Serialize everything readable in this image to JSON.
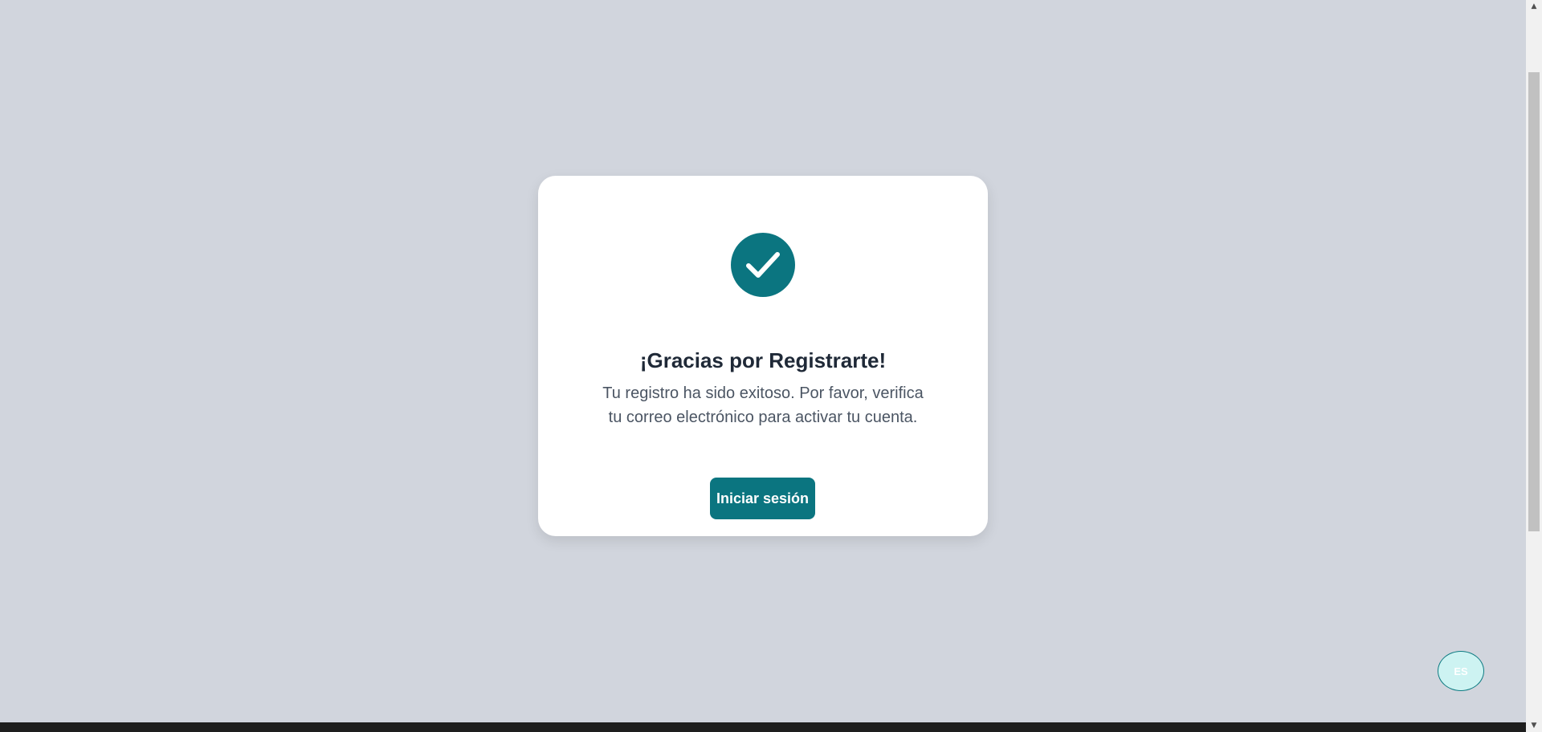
{
  "confirmation": {
    "icon": "check-circle-icon",
    "title": "¡Gracias por Registrarte!",
    "message_line1": "Tu registro ha sido exitoso. Por favor, verifica",
    "message_line2": "tu correo electrónico para activar tu cuenta.",
    "login_button_label": "Iniciar sesión"
  },
  "language_switcher": {
    "label": "ES"
  },
  "colors": {
    "background": "#d1d5dd",
    "card": "#ffffff",
    "accent": "#0b7580",
    "title_text": "#1f2937",
    "body_text": "#4b5563",
    "lang_button_bg": "#cdf3f2",
    "footer": "#1e1e1e"
  },
  "scrollbar": {
    "up_icon": "triangle-up-icon",
    "down_icon": "triangle-down-icon"
  }
}
